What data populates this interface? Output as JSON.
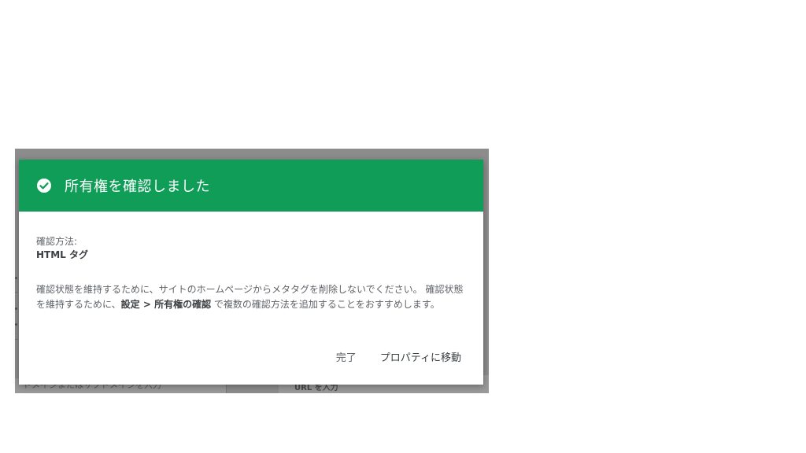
{
  "background": {
    "left_input_placeholder": "ドメインまたはサブドメインを入力",
    "right_input_placeholder": "URL を入力"
  },
  "dialog": {
    "header_color": "#0f9d58",
    "icon": "check-circle-icon",
    "title": "所有権を確認しました",
    "method_label": "確認方法:",
    "method_value": "HTML タグ",
    "description_part1": "確認状態を維持するために、サイトのホームページからメタタグを削除しないでください。 確認状態を維持するために、",
    "description_bold": "設定 > 所有権の確認",
    "description_part2": " で複数の確認方法を追加することをおすすめします。",
    "done_button": "完了",
    "goto_property_button": "プロパティに移動"
  }
}
